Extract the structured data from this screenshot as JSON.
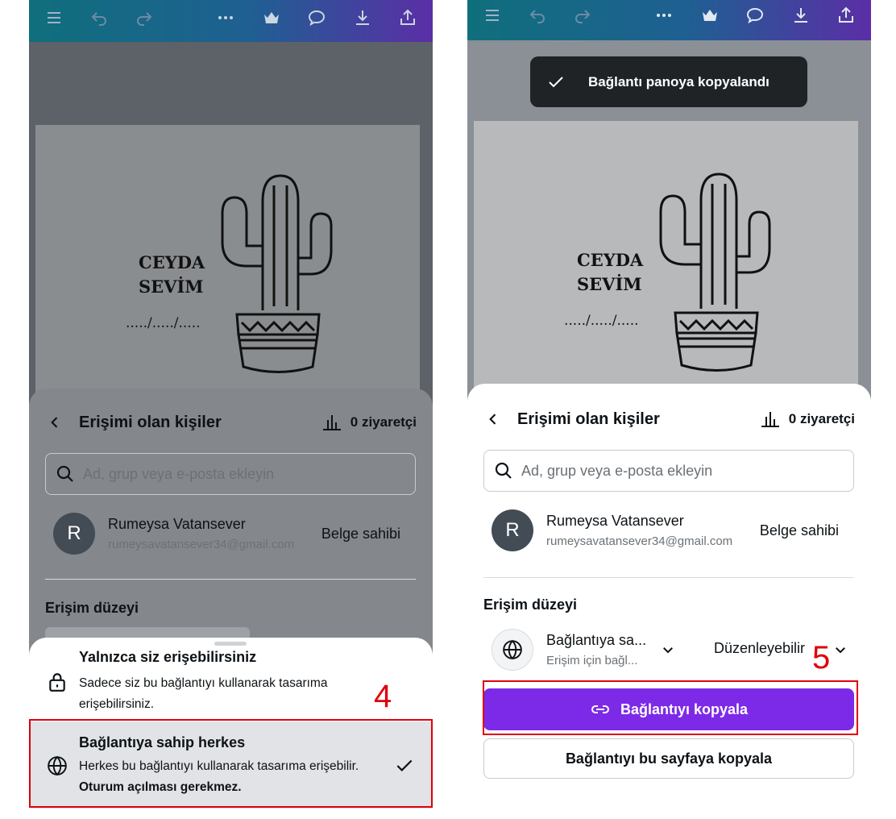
{
  "left": {
    "artboard": {
      "line1": "CEYDA",
      "line2": "SEVİM",
      "date": "...../...../....."
    },
    "sheet": {
      "title": "Erişimi olan kişiler",
      "visitors": "0 ziyaretçi",
      "search_placeholder": "Ad, grup veya e-posta ekleyin",
      "user": {
        "initial": "R",
        "name": "Rumeysa Vatansever",
        "email": "rumeysavatansever34@gmail.com",
        "role": "Belge sahibi"
      },
      "access_label": "Erişim düzeyi"
    },
    "menu": {
      "options": [
        {
          "title": "Yalnızca siz erişebilirsiniz",
          "desc": "Sadece siz bu bağlantıyı kullanarak tasarıma erişebilirsiniz.",
          "icon": "lock-icon",
          "selected": false
        },
        {
          "title": "Bağlantıya sahip herkes",
          "desc": "Herkes bu bağlantıyı kullanarak tasarıma erişebilir.",
          "desc_bold": "Oturum açılması gerekmez.",
          "icon": "globe-icon",
          "selected": true
        }
      ]
    },
    "annotation": "4"
  },
  "right": {
    "toast": "Bağlantı panoya kopyalandı",
    "artboard": {
      "line1": "CEYDA",
      "line2": "SEVİM",
      "date": "...../...../....."
    },
    "sheet": {
      "title": "Erişimi olan kişiler",
      "visitors": "0 ziyaretçi",
      "search_placeholder": "Ad, grup veya e-posta ekleyin",
      "user": {
        "initial": "R",
        "name": "Rumeysa Vatansever",
        "email": "rumeysavatansever34@gmail.com",
        "role": "Belge sahibi"
      },
      "access_label": "Erişim düzeyi",
      "access": {
        "title": "Bağlantıya sa...",
        "sub": "Erişim için bağl...",
        "permission": "Düzenleyebilir"
      },
      "copy_button": "Bağlantıyı kopyala",
      "copy_page_button": "Bağlantıyı bu sayfaya kopyala"
    },
    "annotation": "5"
  },
  "colors": {
    "accent": "#7d2ae8",
    "annotation": "#e0000a",
    "toast_bg": "#1f2326"
  }
}
